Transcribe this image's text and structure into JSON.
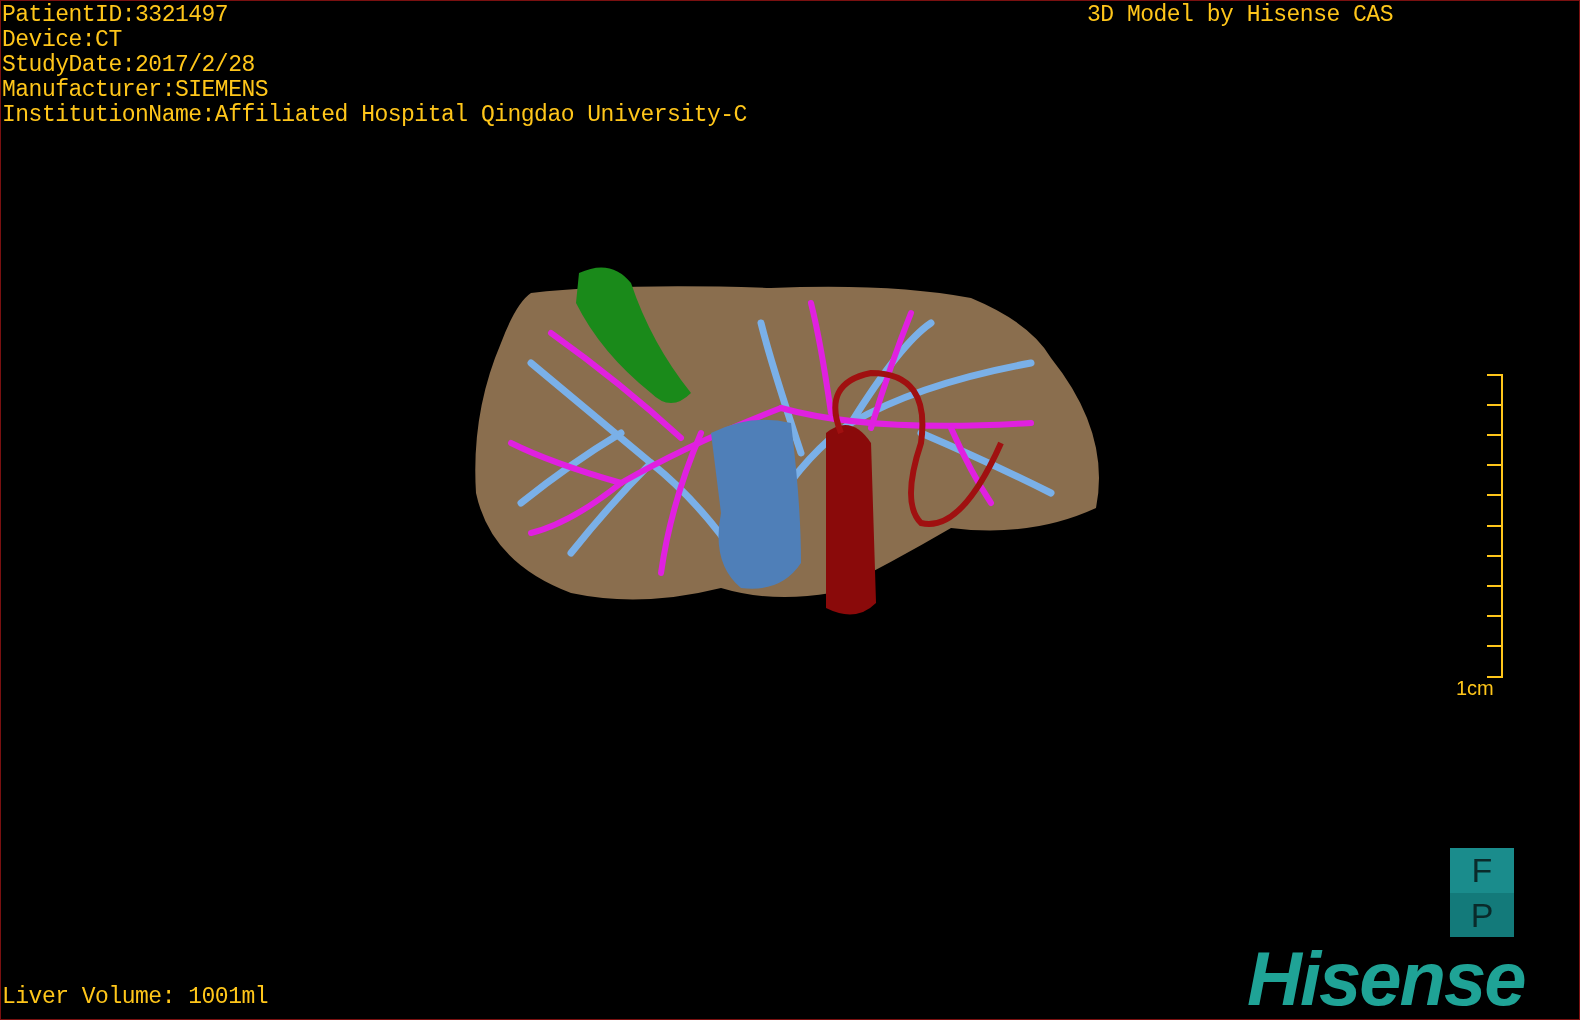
{
  "patient_info": [
    "PatientID:3321497",
    "Device:CT",
    "StudyDate:2017/2/28",
    "Manufacturer:SIEMENS",
    "InstitutionName:Affiliated Hospital Qingdao University-C"
  ],
  "title": "3D Model by Hisense CAS",
  "scale_bar": {
    "label": "1cm"
  },
  "orientation_box": [
    "F",
    "P"
  ],
  "logo": "Hisense",
  "liver_volume": "Liver Volume: 1001ml"
}
